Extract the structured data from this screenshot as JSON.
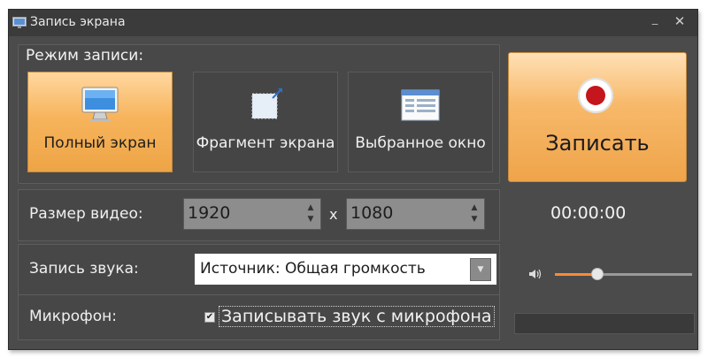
{
  "window": {
    "title": "Запись экрана"
  },
  "mode": {
    "label": "Режим записи:",
    "buttons": [
      {
        "label": "Полный экран",
        "icon": "monitor-icon",
        "selected": true
      },
      {
        "label": "Фрагмент экрана",
        "icon": "screen-fragment-icon",
        "selected": false
      },
      {
        "label": "Выбранное окно",
        "icon": "window-icon",
        "selected": false
      }
    ]
  },
  "record": {
    "label": "Записать",
    "icon": "record-icon"
  },
  "video_size": {
    "label": "Размер видео:",
    "width": "1920",
    "separator": "x",
    "height": "1080"
  },
  "audio": {
    "label": "Запись звука:",
    "source": "Источник: Общая громкость"
  },
  "mic": {
    "label": "Микрофон:",
    "checkbox_label": "Записывать звук с микрофона",
    "checked": true
  },
  "timer": "00:00:00",
  "volume": {
    "level": 0.3
  },
  "colors": {
    "accent": "#f7b45c",
    "record_red": "#c4161c",
    "background": "#4b4b4b"
  }
}
